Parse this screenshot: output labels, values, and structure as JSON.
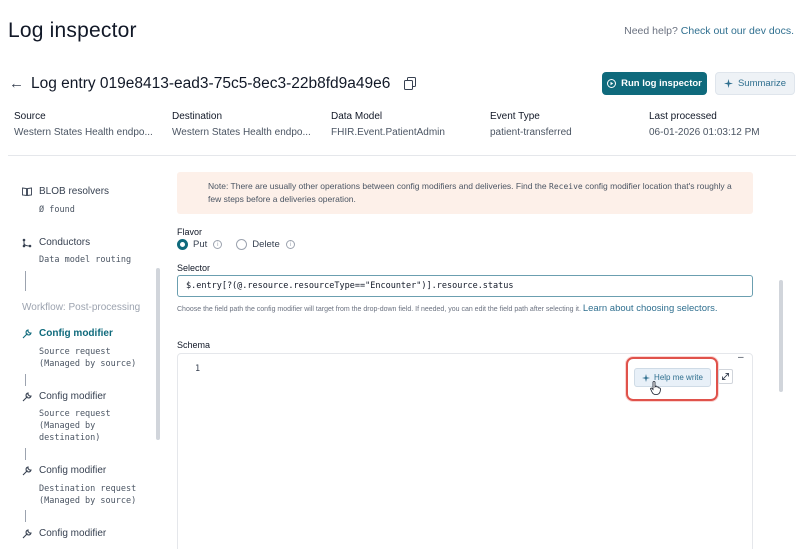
{
  "header": {
    "title": "Log inspector",
    "help_prefix": "Need help?",
    "help_link": "Check out our dev docs."
  },
  "entry": {
    "title": "Log entry 019e8413-ead3-75c5-8ec3-22b8fd9a49e6",
    "run_button": "Run log inspector",
    "summarize_button": "Summarize"
  },
  "meta": [
    {
      "label": "Source",
      "value": "Western States Health endpo..."
    },
    {
      "label": "Destination",
      "value": "Western States Health endpo..."
    },
    {
      "label": "Data Model",
      "value": "FHIR.Event.PatientAdmin"
    },
    {
      "label": "Event Type",
      "value": "patient-transferred"
    },
    {
      "label": "Last processed",
      "value": "06-01-2026 01:03:12 PM"
    }
  ],
  "sidebar": {
    "items": [
      {
        "label": "BLOB resolvers",
        "sub": "Ø found"
      },
      {
        "label": "Conductors",
        "sub": "Data model routing"
      },
      {
        "label": "Config modifier",
        "sub": "Source request\n(Managed by source)"
      },
      {
        "label": "Config modifier",
        "sub": "Source request\n(Managed by\ndestination)"
      },
      {
        "label": "Config modifier",
        "sub": "Destination request\n(Managed by source)"
      },
      {
        "label": "Config modifier"
      }
    ],
    "section": "Workflow: Post-processing"
  },
  "form": {
    "note_before": "Note: There are usually other operations between config modifiers and deliveries. Find the",
    "note_code": "Receive",
    "note_after": "config modifier location that's roughly a few steps before a deliveries operation.",
    "flavor_label": "Flavor",
    "flavor_options": [
      "Put",
      "Delete"
    ],
    "flavor_selected": "Put",
    "selector_label": "Selector",
    "selector_value": "$.entry[?(@.resource.resourceType==\"Encounter\")].resource.status",
    "selector_help": "Choose the field path the config modifier will target from the drop-down field. If needed, you can edit the field path after selecting it.",
    "selector_help_link": "Learn about choosing selectors.",
    "schema_label": "Schema",
    "schema_line": "1",
    "help_write": "Help me write"
  },
  "colors": {
    "primary": "#0f6a7c",
    "link": "#2f6f8f",
    "note_bg": "#fdf0e9",
    "highlight": "#e0524b"
  }
}
